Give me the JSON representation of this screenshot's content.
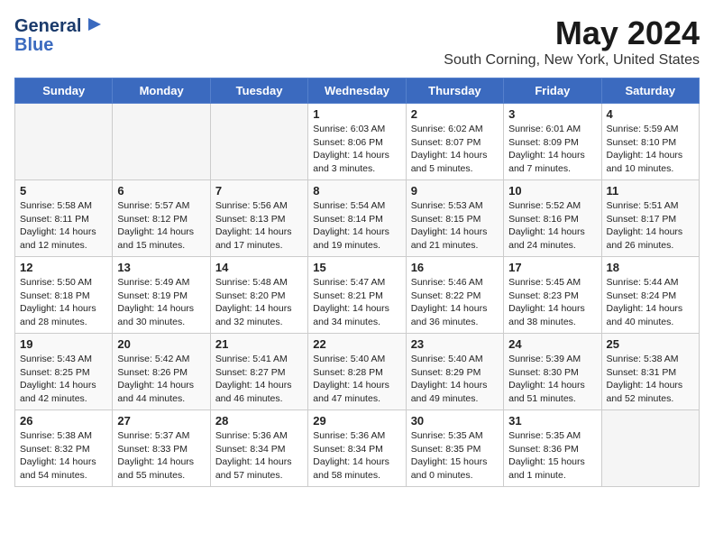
{
  "header": {
    "logo_line1": "General",
    "logo_line2": "Blue",
    "month": "May 2024",
    "location": "South Corning, New York, United States"
  },
  "weekdays": [
    "Sunday",
    "Monday",
    "Tuesday",
    "Wednesday",
    "Thursday",
    "Friday",
    "Saturday"
  ],
  "weeks": [
    [
      {
        "day": "",
        "sunrise": "",
        "sunset": "",
        "daylight": ""
      },
      {
        "day": "",
        "sunrise": "",
        "sunset": "",
        "daylight": ""
      },
      {
        "day": "",
        "sunrise": "",
        "sunset": "",
        "daylight": ""
      },
      {
        "day": "1",
        "sunrise": "Sunrise: 6:03 AM",
        "sunset": "Sunset: 8:06 PM",
        "daylight": "Daylight: 14 hours and 3 minutes."
      },
      {
        "day": "2",
        "sunrise": "Sunrise: 6:02 AM",
        "sunset": "Sunset: 8:07 PM",
        "daylight": "Daylight: 14 hours and 5 minutes."
      },
      {
        "day": "3",
        "sunrise": "Sunrise: 6:01 AM",
        "sunset": "Sunset: 8:09 PM",
        "daylight": "Daylight: 14 hours and 7 minutes."
      },
      {
        "day": "4",
        "sunrise": "Sunrise: 5:59 AM",
        "sunset": "Sunset: 8:10 PM",
        "daylight": "Daylight: 14 hours and 10 minutes."
      }
    ],
    [
      {
        "day": "5",
        "sunrise": "Sunrise: 5:58 AM",
        "sunset": "Sunset: 8:11 PM",
        "daylight": "Daylight: 14 hours and 12 minutes."
      },
      {
        "day": "6",
        "sunrise": "Sunrise: 5:57 AM",
        "sunset": "Sunset: 8:12 PM",
        "daylight": "Daylight: 14 hours and 15 minutes."
      },
      {
        "day": "7",
        "sunrise": "Sunrise: 5:56 AM",
        "sunset": "Sunset: 8:13 PM",
        "daylight": "Daylight: 14 hours and 17 minutes."
      },
      {
        "day": "8",
        "sunrise": "Sunrise: 5:54 AM",
        "sunset": "Sunset: 8:14 PM",
        "daylight": "Daylight: 14 hours and 19 minutes."
      },
      {
        "day": "9",
        "sunrise": "Sunrise: 5:53 AM",
        "sunset": "Sunset: 8:15 PM",
        "daylight": "Daylight: 14 hours and 21 minutes."
      },
      {
        "day": "10",
        "sunrise": "Sunrise: 5:52 AM",
        "sunset": "Sunset: 8:16 PM",
        "daylight": "Daylight: 14 hours and 24 minutes."
      },
      {
        "day": "11",
        "sunrise": "Sunrise: 5:51 AM",
        "sunset": "Sunset: 8:17 PM",
        "daylight": "Daylight: 14 hours and 26 minutes."
      }
    ],
    [
      {
        "day": "12",
        "sunrise": "Sunrise: 5:50 AM",
        "sunset": "Sunset: 8:18 PM",
        "daylight": "Daylight: 14 hours and 28 minutes."
      },
      {
        "day": "13",
        "sunrise": "Sunrise: 5:49 AM",
        "sunset": "Sunset: 8:19 PM",
        "daylight": "Daylight: 14 hours and 30 minutes."
      },
      {
        "day": "14",
        "sunrise": "Sunrise: 5:48 AM",
        "sunset": "Sunset: 8:20 PM",
        "daylight": "Daylight: 14 hours and 32 minutes."
      },
      {
        "day": "15",
        "sunrise": "Sunrise: 5:47 AM",
        "sunset": "Sunset: 8:21 PM",
        "daylight": "Daylight: 14 hours and 34 minutes."
      },
      {
        "day": "16",
        "sunrise": "Sunrise: 5:46 AM",
        "sunset": "Sunset: 8:22 PM",
        "daylight": "Daylight: 14 hours and 36 minutes."
      },
      {
        "day": "17",
        "sunrise": "Sunrise: 5:45 AM",
        "sunset": "Sunset: 8:23 PM",
        "daylight": "Daylight: 14 hours and 38 minutes."
      },
      {
        "day": "18",
        "sunrise": "Sunrise: 5:44 AM",
        "sunset": "Sunset: 8:24 PM",
        "daylight": "Daylight: 14 hours and 40 minutes."
      }
    ],
    [
      {
        "day": "19",
        "sunrise": "Sunrise: 5:43 AM",
        "sunset": "Sunset: 8:25 PM",
        "daylight": "Daylight: 14 hours and 42 minutes."
      },
      {
        "day": "20",
        "sunrise": "Sunrise: 5:42 AM",
        "sunset": "Sunset: 8:26 PM",
        "daylight": "Daylight: 14 hours and 44 minutes."
      },
      {
        "day": "21",
        "sunrise": "Sunrise: 5:41 AM",
        "sunset": "Sunset: 8:27 PM",
        "daylight": "Daylight: 14 hours and 46 minutes."
      },
      {
        "day": "22",
        "sunrise": "Sunrise: 5:40 AM",
        "sunset": "Sunset: 8:28 PM",
        "daylight": "Daylight: 14 hours and 47 minutes."
      },
      {
        "day": "23",
        "sunrise": "Sunrise: 5:40 AM",
        "sunset": "Sunset: 8:29 PM",
        "daylight": "Daylight: 14 hours and 49 minutes."
      },
      {
        "day": "24",
        "sunrise": "Sunrise: 5:39 AM",
        "sunset": "Sunset: 8:30 PM",
        "daylight": "Daylight: 14 hours and 51 minutes."
      },
      {
        "day": "25",
        "sunrise": "Sunrise: 5:38 AM",
        "sunset": "Sunset: 8:31 PM",
        "daylight": "Daylight: 14 hours and 52 minutes."
      }
    ],
    [
      {
        "day": "26",
        "sunrise": "Sunrise: 5:38 AM",
        "sunset": "Sunset: 8:32 PM",
        "daylight": "Daylight: 14 hours and 54 minutes."
      },
      {
        "day": "27",
        "sunrise": "Sunrise: 5:37 AM",
        "sunset": "Sunset: 8:33 PM",
        "daylight": "Daylight: 14 hours and 55 minutes."
      },
      {
        "day": "28",
        "sunrise": "Sunrise: 5:36 AM",
        "sunset": "Sunset: 8:34 PM",
        "daylight": "Daylight: 14 hours and 57 minutes."
      },
      {
        "day": "29",
        "sunrise": "Sunrise: 5:36 AM",
        "sunset": "Sunset: 8:34 PM",
        "daylight": "Daylight: 14 hours and 58 minutes."
      },
      {
        "day": "30",
        "sunrise": "Sunrise: 5:35 AM",
        "sunset": "Sunset: 8:35 PM",
        "daylight": "Daylight: 15 hours and 0 minutes."
      },
      {
        "day": "31",
        "sunrise": "Sunrise: 5:35 AM",
        "sunset": "Sunset: 8:36 PM",
        "daylight": "Daylight: 15 hours and 1 minute."
      },
      {
        "day": "",
        "sunrise": "",
        "sunset": "",
        "daylight": ""
      }
    ]
  ]
}
